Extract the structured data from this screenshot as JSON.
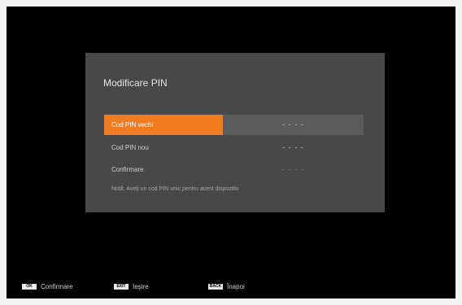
{
  "dialog": {
    "title": "Modificare PIN",
    "rows": [
      {
        "label": "Cod PIN vechi",
        "value": "- - - -"
      },
      {
        "label": "Cod PIN nou",
        "value": "- - - -"
      },
      {
        "label": "Confirmare",
        "value": "- - - -"
      }
    ],
    "note": "Notă: Aveţi un cod PIN unic pentru acest dispozitiv."
  },
  "footer": {
    "items": [
      {
        "key": "OK",
        "label": "Confirmare"
      },
      {
        "key": "EXIT",
        "label": "Ieşire"
      },
      {
        "key": "BACK",
        "label": "Înapoi"
      }
    ]
  },
  "colors": {
    "accent": "#f07c22",
    "dialog_bg": "#484848",
    "screen_bg": "#000000"
  }
}
